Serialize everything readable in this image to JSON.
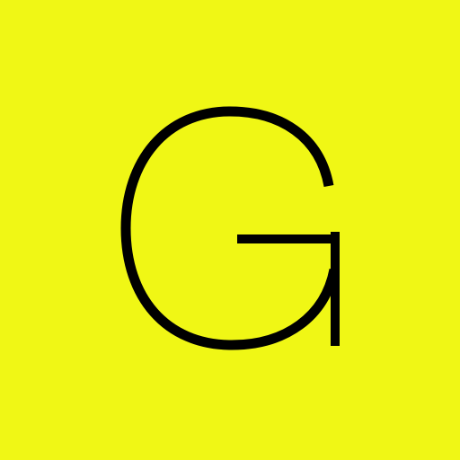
{
  "logo": {
    "letter": "G",
    "background_color": "#F0F715",
    "glyph_color": "#000000"
  }
}
